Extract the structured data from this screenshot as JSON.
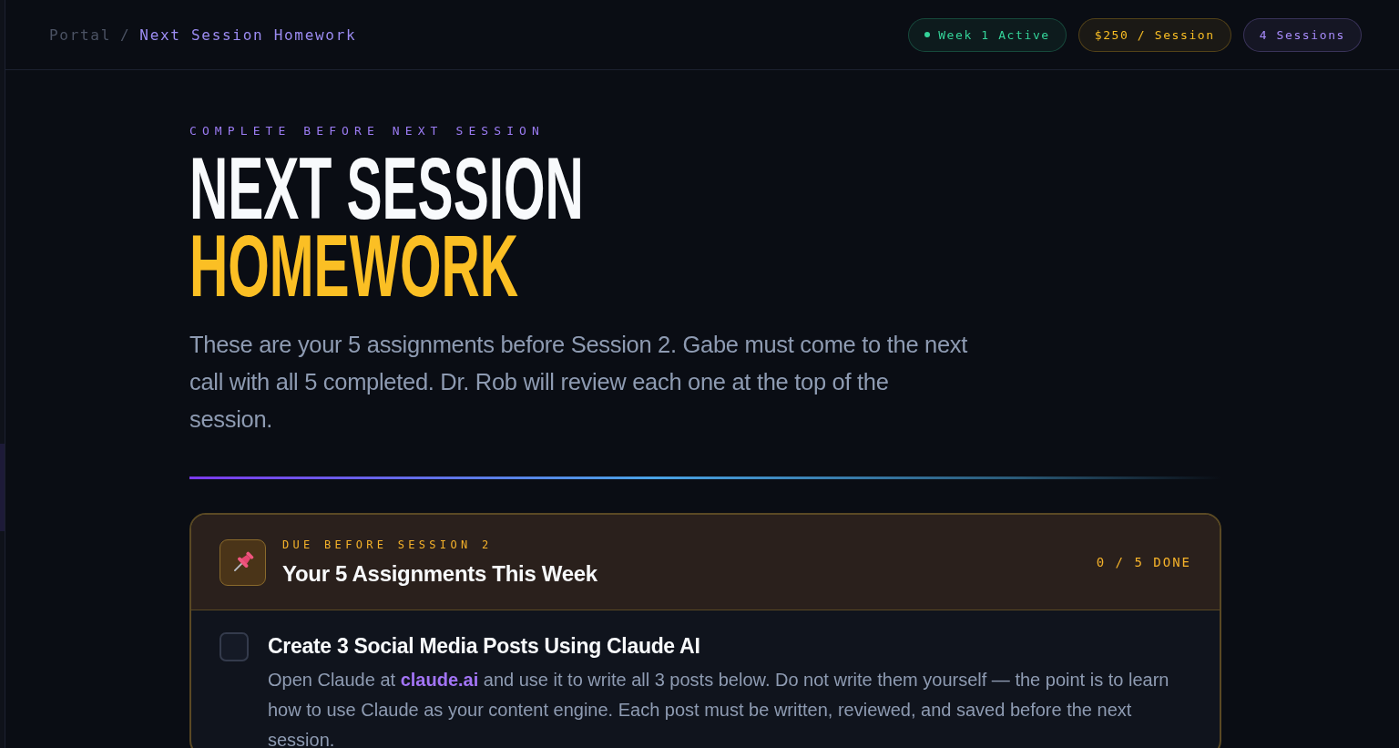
{
  "breadcrumb": {
    "separator": "/",
    "items": [
      {
        "label": "Portal",
        "current": false
      },
      {
        "label": "Next Session Homework",
        "current": true
      }
    ]
  },
  "badges": [
    {
      "label": "Week 1 Active",
      "color": "#34d399",
      "dot": true
    },
    {
      "label": "$250 / Session",
      "color": "#fbbf24",
      "dot": false
    },
    {
      "label": "4 Sessions",
      "color": "#a78bfa",
      "dot": false
    }
  ],
  "eyebrow": "COMPLETE BEFORE NEXT SESSION",
  "title_lines": [
    {
      "text": "NEXT SESSION",
      "accent": false
    },
    {
      "text": "HOMEWORK",
      "accent": true
    }
  ],
  "intro": "These are your 5 assignments before Session 2. Gabe must come to the next call with all 5 completed. Dr. Rob will review each one at the top of the session.",
  "card": {
    "eyebrow": "DUE BEFORE SESSION 2",
    "title": "Your 5 Assignments This Week",
    "progress": "0 / 5 DONE",
    "assignments": [
      {
        "checked": false,
        "title": "Create 3 Social Media Posts Using Claude AI",
        "description": [
          {
            "kind": "text",
            "text": "Open Claude at "
          },
          {
            "kind": "link",
            "text": "claude.ai"
          },
          {
            "kind": "text",
            "text": " and use it to write all 3 posts below. Do not write them yourself — the point is to learn how to use Claude as your content engine. Each post must be written, reviewed, and saved before the next session."
          }
        ]
      }
    ]
  }
}
